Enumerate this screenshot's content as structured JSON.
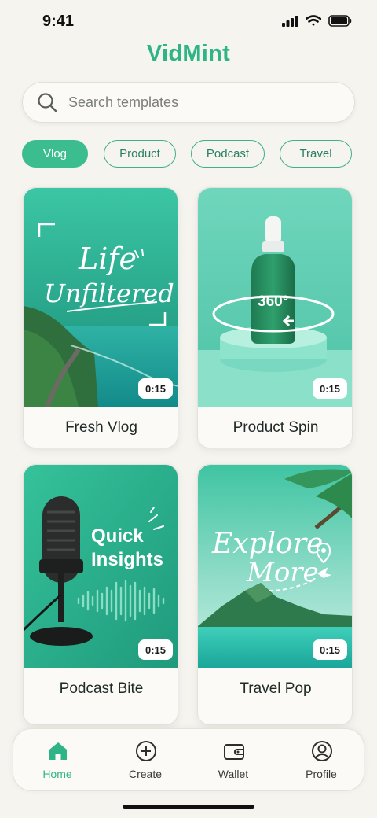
{
  "status": {
    "time": "9:41",
    "icons": [
      "signal-icon",
      "wifi-icon",
      "battery-icon"
    ]
  },
  "app": {
    "title": "VidMint"
  },
  "search": {
    "placeholder": "Search templates",
    "value": ""
  },
  "filters": [
    {
      "label": "Vlog",
      "active": true
    },
    {
      "label": "Product",
      "active": false
    },
    {
      "label": "Podcast",
      "active": false
    },
    {
      "label": "Travel",
      "active": false
    }
  ],
  "templates": [
    {
      "title": "Fresh Vlog",
      "duration": "0:15",
      "overlay_lines": [
        "Life",
        "Unfiltered"
      ]
    },
    {
      "title": "Product Spin",
      "duration": "0:15",
      "overlay_text": "360°"
    },
    {
      "title": "Podcast Bite",
      "duration": "0:15",
      "overlay_lines": [
        "Quick",
        "Insights"
      ]
    },
    {
      "title": "Travel Pop",
      "duration": "0:15",
      "overlay_lines": [
        "Explore",
        "More"
      ]
    }
  ],
  "nav": [
    {
      "label": "Home",
      "icon": "home-icon",
      "active": true
    },
    {
      "label": "Create",
      "icon": "plus-circle-icon",
      "active": false
    },
    {
      "label": "Wallet",
      "icon": "wallet-icon",
      "active": false
    },
    {
      "label": "Profile",
      "icon": "user-circle-icon",
      "active": false
    }
  ],
  "colors": {
    "accent": "#2fb487",
    "chip_border": "#3fae8a",
    "background": "#f6f4ef",
    "card": "#fbfaf7"
  }
}
